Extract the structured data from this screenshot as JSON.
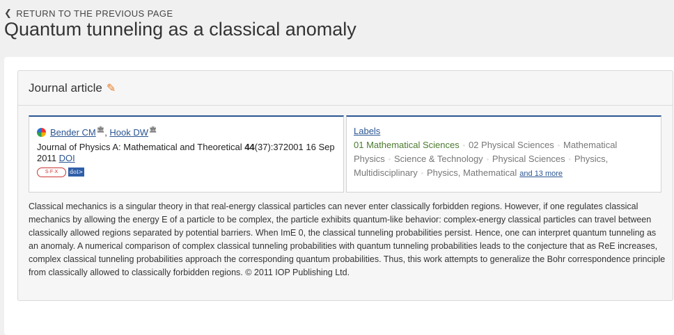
{
  "nav": {
    "back_label": "RETURN TO THE PREVIOUS PAGE"
  },
  "page": {
    "title": "Quantum tunneling as a classical anomaly"
  },
  "panel": {
    "type_label": "Journal article"
  },
  "authors": [
    {
      "name": "Bender CM"
    },
    {
      "name": "Hook DW"
    }
  ],
  "author_separator": ", ",
  "citation": {
    "journal": "Journal of Physics A: Mathematical and Theoretical ",
    "volume": "44",
    "issue_page": "(37):372001 16 Sep 2011 ",
    "doi_link": "DOI"
  },
  "badges": {
    "sfx": "S·F·X",
    "doi": "doi>"
  },
  "labels": {
    "title": "Labels",
    "items": [
      "01 Mathematical Sciences",
      "02 Physical Sciences",
      "Mathematical Physics",
      "Science & Technology",
      "Physical Sciences",
      "Physics, Multidisciplinary",
      "Physics, Mathematical"
    ],
    "more": "and 13 more"
  },
  "abstract": "Classical mechanics is a singular theory in that real-energy classical particles can never enter classically forbidden regions. However, if one regulates classical mechanics by allowing the energy E of a particle to be complex, the particle exhibits quantum-like behavior: complex-energy classical particles can travel between classically allowed regions separated by potential barriers. When ImE 0, the classical tunneling probabilities persist. Hence, one can interpret quantum tunneling as an anomaly. A numerical comparison of complex classical tunneling probabilities with quantum tunneling probabilities leads to the conjecture that as ReE increases, complex classical tunneling probabilities approach the corresponding quantum probabilities. Thus, this work attempts to generalize the Bohr correspondence principle from classically allowed to classically forbidden regions. © 2011 IOP Publishing Ltd.",
  "icons": {
    "back": "chevron-left-icon",
    "edit": "pencil-icon",
    "orcid": "orcid-icon",
    "institution": "institution-icon"
  },
  "colors": {
    "link": "#2a5592",
    "edit_icon": "#e8791e",
    "first_label": "#4a7a2e"
  }
}
